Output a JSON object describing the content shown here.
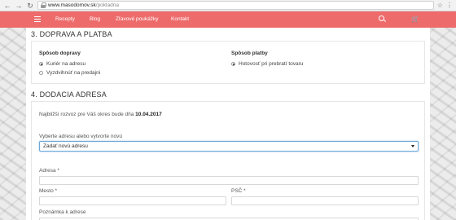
{
  "browser": {
    "url_host": "www.masodomov.sk",
    "url_path": "/pokladna"
  },
  "nav": {
    "links": [
      "Recepty",
      "Blog",
      "Zľavové poukážky",
      "Kontakt"
    ]
  },
  "shipping_section": {
    "title": "3. DOPRAVA A PLATBA",
    "delivery_heading": "Spôsob dopravy",
    "delivery_options": [
      "Kuriér na adresu",
      "Vyzdvihnúť na predajni"
    ],
    "delivery_selected": "Kuriér na adresu",
    "payment_heading": "Spôsob platby",
    "payment_options": [
      "Hotovosť pri prebratí tovaru"
    ],
    "payment_selected": "Hotovosť pri prebratí tovaru"
  },
  "address_section": {
    "title": "4. DODACIA ADRESA",
    "delivery_note_prefix": "Najbližší rozvoz pre Váš okres bude dňa",
    "delivery_date": "10.04.2017",
    "select_label": "Vyberte adresu alebo vytvorte novú",
    "select_value": "Zadať novú adresu",
    "address_label": "Adresa *",
    "city_label": "Mesto *",
    "zip_label": "PSČ *",
    "note_label": "Poznámka k adrese"
  }
}
